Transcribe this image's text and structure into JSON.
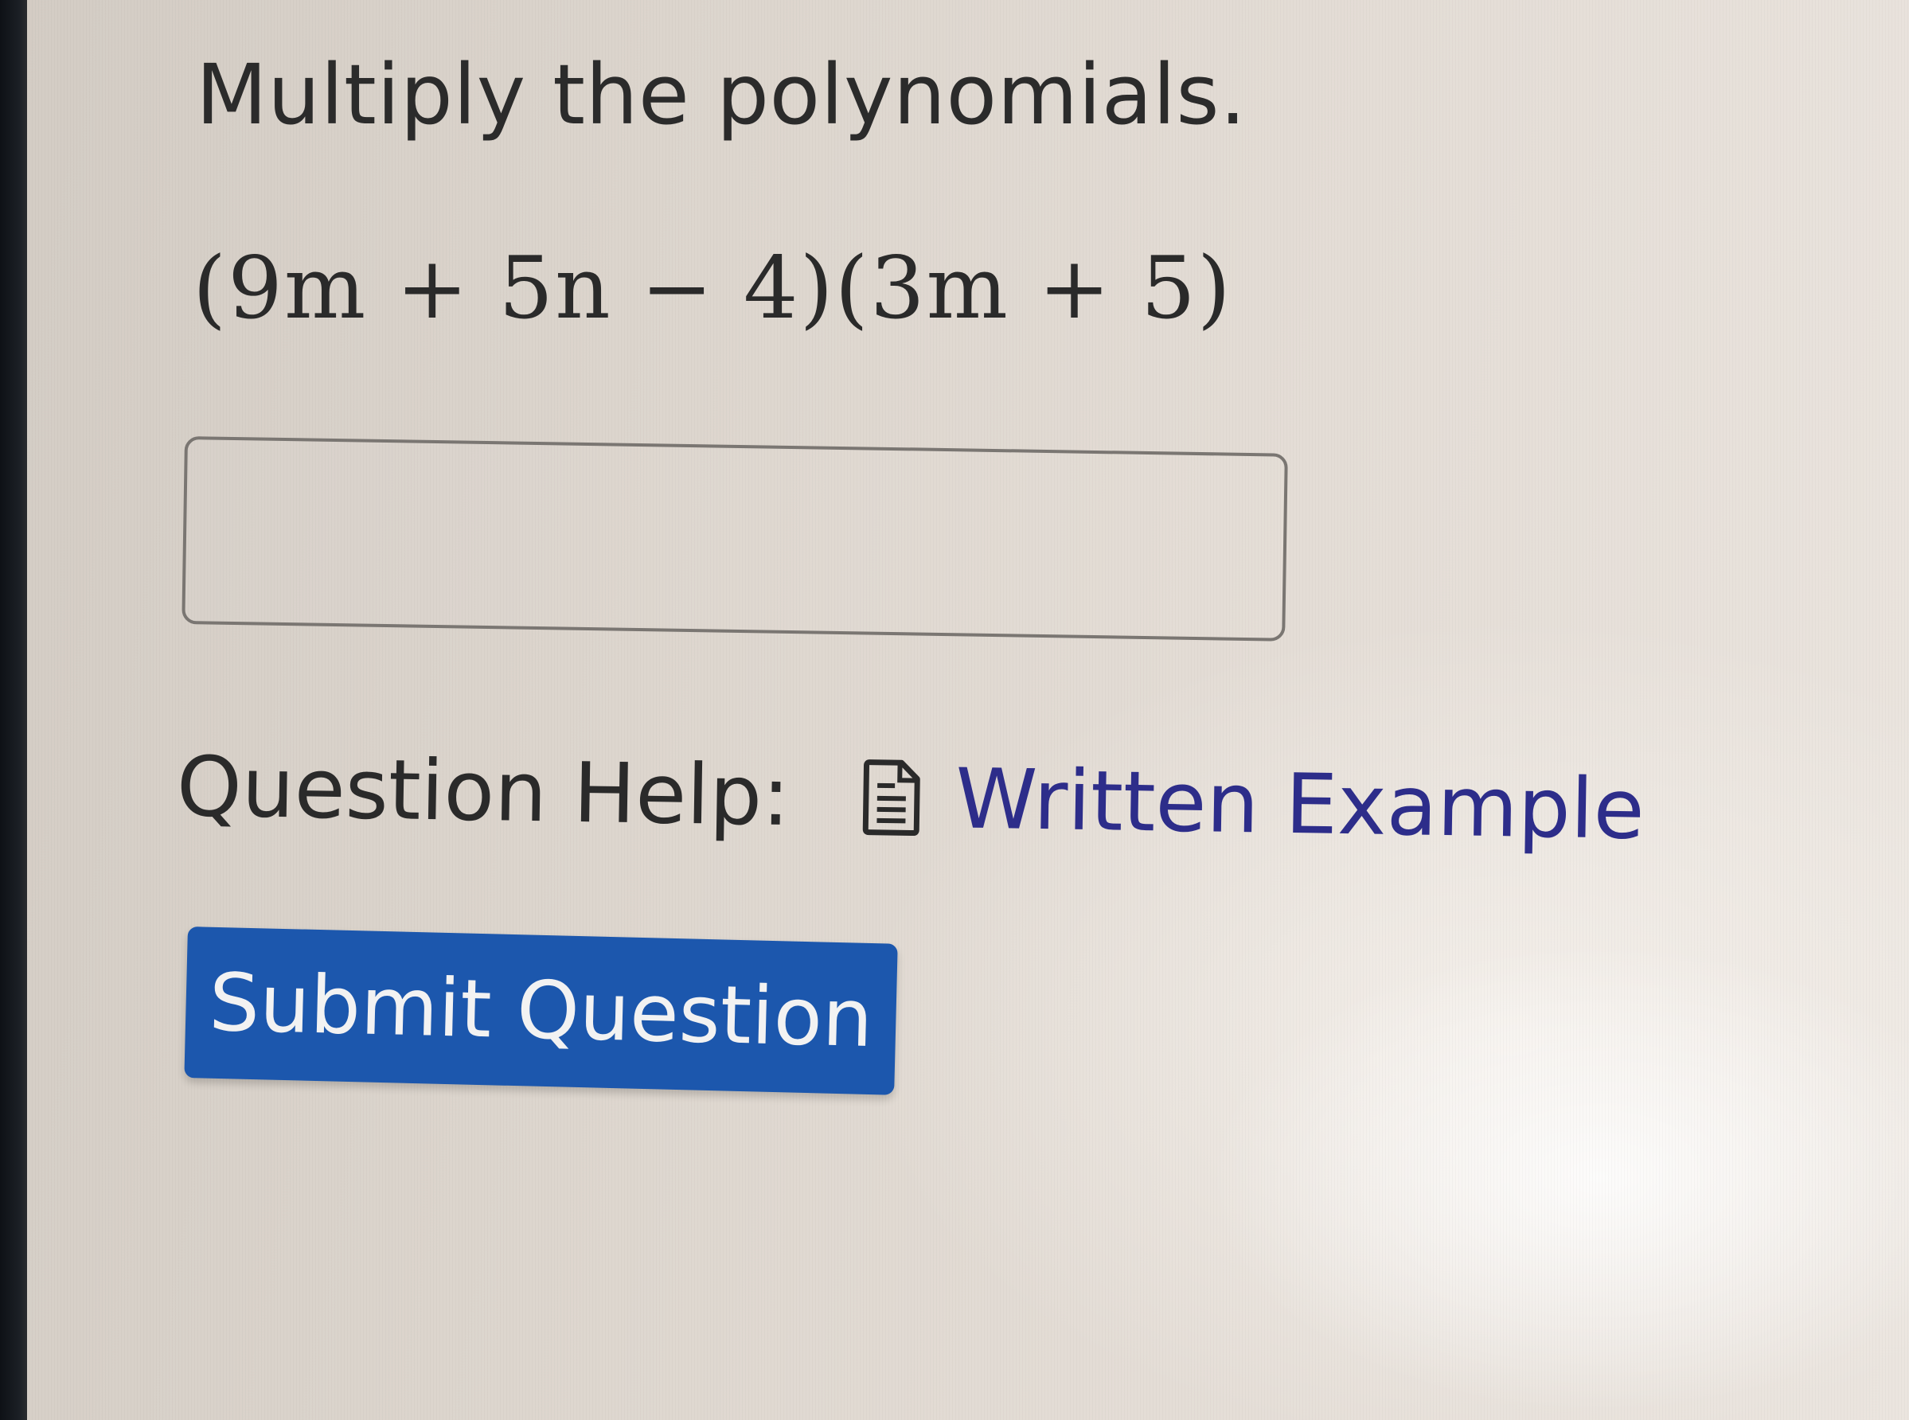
{
  "question": {
    "title": "Multiply the polynomials.",
    "expression": "(9m + 5n − 4)(3m + 5)"
  },
  "answer": {
    "value": "",
    "placeholder": ""
  },
  "help": {
    "label": "Question Help:",
    "icon": "document-icon",
    "link_label": "Written Example",
    "link_color": "#2d2d8a"
  },
  "submit": {
    "label": "Submit Question",
    "color": "#1c57ad"
  }
}
